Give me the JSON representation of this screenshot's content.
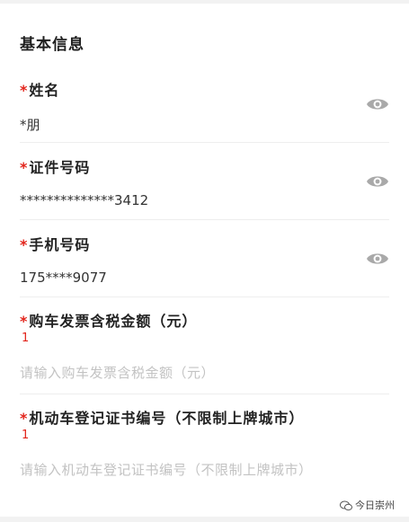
{
  "section": {
    "title": "基本信息"
  },
  "required_mark": "*",
  "fields": {
    "name": {
      "label": "姓名",
      "value": "*朋",
      "eye_icon": "eye-icon"
    },
    "id_number": {
      "label": "证件号码",
      "value": "**************3412",
      "eye_icon": "eye-icon"
    },
    "phone": {
      "label": "手机号码",
      "value": "175****9077",
      "eye_icon": "eye-icon"
    },
    "invoice_amount": {
      "label": "购车发票含税金额（元）",
      "count": "1",
      "value": "",
      "placeholder": "请输入购车发票含税金额（元）"
    },
    "registration_no": {
      "label": "机动车登记证书编号（不限制上牌城市）",
      "count": "1",
      "value": "",
      "placeholder": "请输入机动车登记证书编号（不限制上牌城市）"
    }
  },
  "watermark": {
    "text": "今日崇州",
    "icon": "wechat-icon"
  },
  "colors": {
    "required": "#e2231a",
    "placeholder": "#c3c3c3",
    "icon": "#a9a9a9"
  }
}
